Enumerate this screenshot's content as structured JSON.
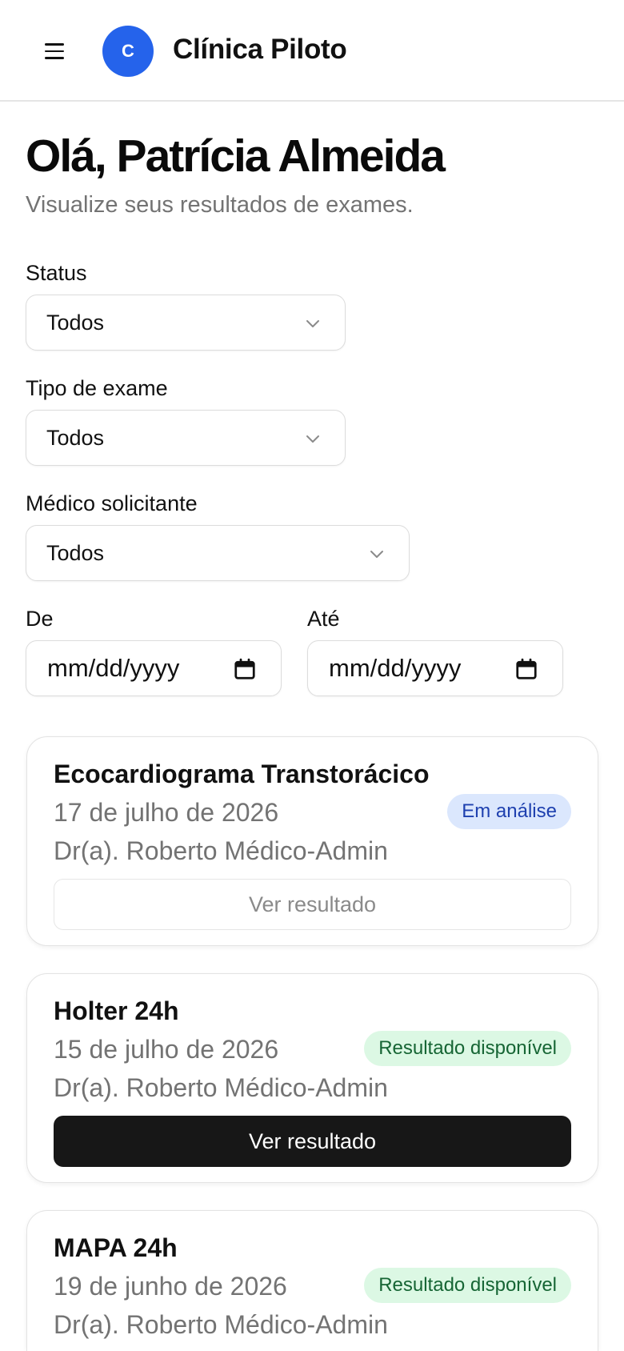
{
  "header": {
    "logo_letter": "C",
    "clinic_name": "Clínica Piloto",
    "brand_color": "#2563eb"
  },
  "page": {
    "greeting": "Olá, Patrícia Almeida",
    "subtitle": "Visualize seus resultados de exames."
  },
  "filters": {
    "status": {
      "label": "Status",
      "value": "Todos"
    },
    "exam_type": {
      "label": "Tipo de exame",
      "value": "Todos"
    },
    "doctor": {
      "label": "Médico solicitante",
      "value": "Todos"
    },
    "date_from": {
      "label": "De",
      "placeholder": "mm/dd/yyyy"
    },
    "date_to": {
      "label": "Até",
      "placeholder": "mm/dd/yyyy"
    }
  },
  "exams": [
    {
      "title": "Ecocardiograma Transtorácico",
      "date": "17 de julho de 2026",
      "doctor": "Dr(a). Roberto Médico-Admin",
      "status": "Em análise",
      "action": "Ver resultado"
    },
    {
      "title": "Holter 24h",
      "date": "15 de julho de 2026",
      "doctor": "Dr(a). Roberto Médico-Admin",
      "status": "Resultado disponível",
      "action": "Ver resultado"
    },
    {
      "title": "MAPA 24h",
      "date": "19 de junho de 2026",
      "doctor": "Dr(a). Roberto Médico-Admin",
      "status": "Resultado disponível"
    }
  ],
  "colors": {
    "badge_analysis_bg": "#dbe7fd",
    "badge_analysis_text": "#1e40af",
    "badge_available_bg": "#dcf8e4",
    "badge_available_text": "#166534",
    "primary_button": "#171717"
  }
}
